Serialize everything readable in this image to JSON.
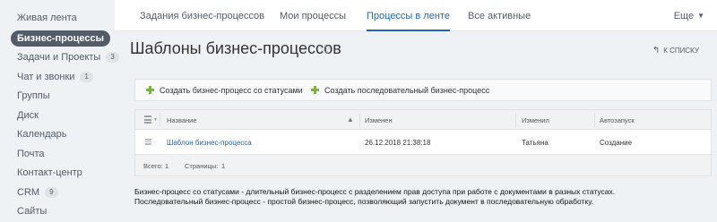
{
  "sidebar": {
    "items": [
      {
        "label": "Живая лента",
        "count": ""
      },
      {
        "label": "Бизнес-процессы",
        "count": ""
      },
      {
        "label": "Задачи и Проекты",
        "count": "3"
      },
      {
        "label": "Чат и звонки",
        "count": "1"
      },
      {
        "label": "Группы",
        "count": ""
      },
      {
        "label": "Диск",
        "count": ""
      },
      {
        "label": "Календарь",
        "count": ""
      },
      {
        "label": "Почта",
        "count": ""
      },
      {
        "label": "Контакт-центр",
        "count": ""
      },
      {
        "label": "CRM",
        "count": "9"
      },
      {
        "label": "Сайты",
        "count": ""
      }
    ]
  },
  "topnav": {
    "tabs": [
      {
        "label": "Задания бизнес-процессов"
      },
      {
        "label": "Мои процессы"
      },
      {
        "label": "Процессы в ленте"
      },
      {
        "label": "Все активные"
      }
    ],
    "more_label": "Еще",
    "more_icon": "chevron-down-icon"
  },
  "page": {
    "title": "Шаблоны бизнес-процессов",
    "star_icon": "star-icon",
    "back_label": "К СПИСКУ"
  },
  "toolbar": {
    "buttons": [
      {
        "label": "Создать бизнес-процесс со статусами",
        "icon": "plus-icon"
      },
      {
        "label": "Создать последовательный бизнес-процесс",
        "icon": "plus-icon"
      }
    ],
    "accent": "#7fb33b"
  },
  "grid": {
    "columns": [
      "Название",
      "Изменен",
      "Изменил",
      "Автозапуск"
    ],
    "rows": [
      {
        "name": "Шаблон бизнес-процесса",
        "modified": "26.12.2018 21:38:18",
        "modified_by": "Татьяна",
        "autostart": "Создание"
      }
    ],
    "footer": {
      "total_label": "Всего: 1",
      "pages_label": "Страницы:",
      "page_number": "1"
    }
  },
  "description": {
    "line1": "Бизнес-процесс со статусами - длительный бизнес-процесс с разделением прав доступа при работе с документами в разных статусах.",
    "line2": "Последовательный бизнес-процесс - простой бизнес-процесс, позволяющий запустить документ в последовательную обработку."
  },
  "colors": {
    "active_tab": "#2067b0",
    "sidebar_active_bg": "#535c69",
    "link": "#2067b0"
  }
}
